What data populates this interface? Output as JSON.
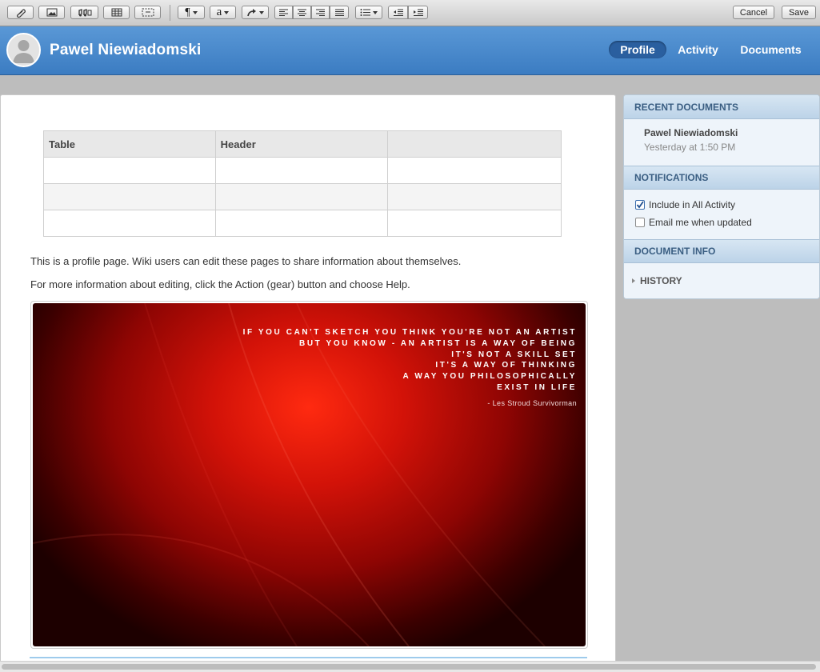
{
  "toolbar": {
    "cancel_label": "Cancel",
    "save_label": "Save",
    "paragraph_glyph": "¶",
    "font_glyph": "a",
    "icons": [
      "attach-icon",
      "image-icon",
      "media-icon",
      "table-icon",
      "block-icon",
      "paragraph-style-icon",
      "text-style-icon",
      "link-icon",
      "align-left-icon",
      "align-center-icon",
      "align-right-icon",
      "justify-icon",
      "list-icon",
      "outdent-icon",
      "indent-icon"
    ]
  },
  "header": {
    "user_name": "Pawel Niewiadomski",
    "tabs": [
      {
        "label": "Profile",
        "active": true
      },
      {
        "label": "Activity",
        "active": false
      },
      {
        "label": "Documents",
        "active": false
      }
    ],
    "colors": {
      "bar": "#3f80c6",
      "active_tab": "#2a5f9f"
    }
  },
  "main": {
    "table": {
      "headers": [
        "Table",
        "Header",
        ""
      ],
      "rows": [
        [
          "",
          "",
          ""
        ],
        [
          "",
          "",
          ""
        ],
        [
          "",
          "",
          ""
        ]
      ]
    },
    "paragraphs": [
      "This is a profile page. Wiki users can edit these pages to share information about themselves.",
      "For more information about editing, click the Action (gear) button and choose Help."
    ],
    "image": {
      "quote_lines": [
        "IF YOU CAN'T SKETCH YOU THINK YOU'RE NOT AN ARTIST",
        "BUT YOU KNOW - AN ARTIST IS A WAY OF BEING",
        "IT'S NOT A SKILL SET",
        "IT'S A WAY OF THINKING",
        "A WAY YOU PHILOSOPHICALLY",
        "EXIST IN LIFE"
      ],
      "author": "- Les Stroud Survivorman"
    }
  },
  "sidebar": {
    "recent_documents": {
      "heading": "RECENT DOCUMENTS",
      "items": [
        {
          "title": "Pawel Niewiadomski",
          "time": "Yesterday at 1:50 PM"
        }
      ]
    },
    "notifications": {
      "heading": "NOTIFICATIONS",
      "options": [
        {
          "label": "Include in All Activity",
          "checked": true
        },
        {
          "label": "Email me when updated",
          "checked": false
        }
      ]
    },
    "document_info": {
      "heading": "DOCUMENT INFO",
      "history_label": "HISTORY"
    }
  }
}
